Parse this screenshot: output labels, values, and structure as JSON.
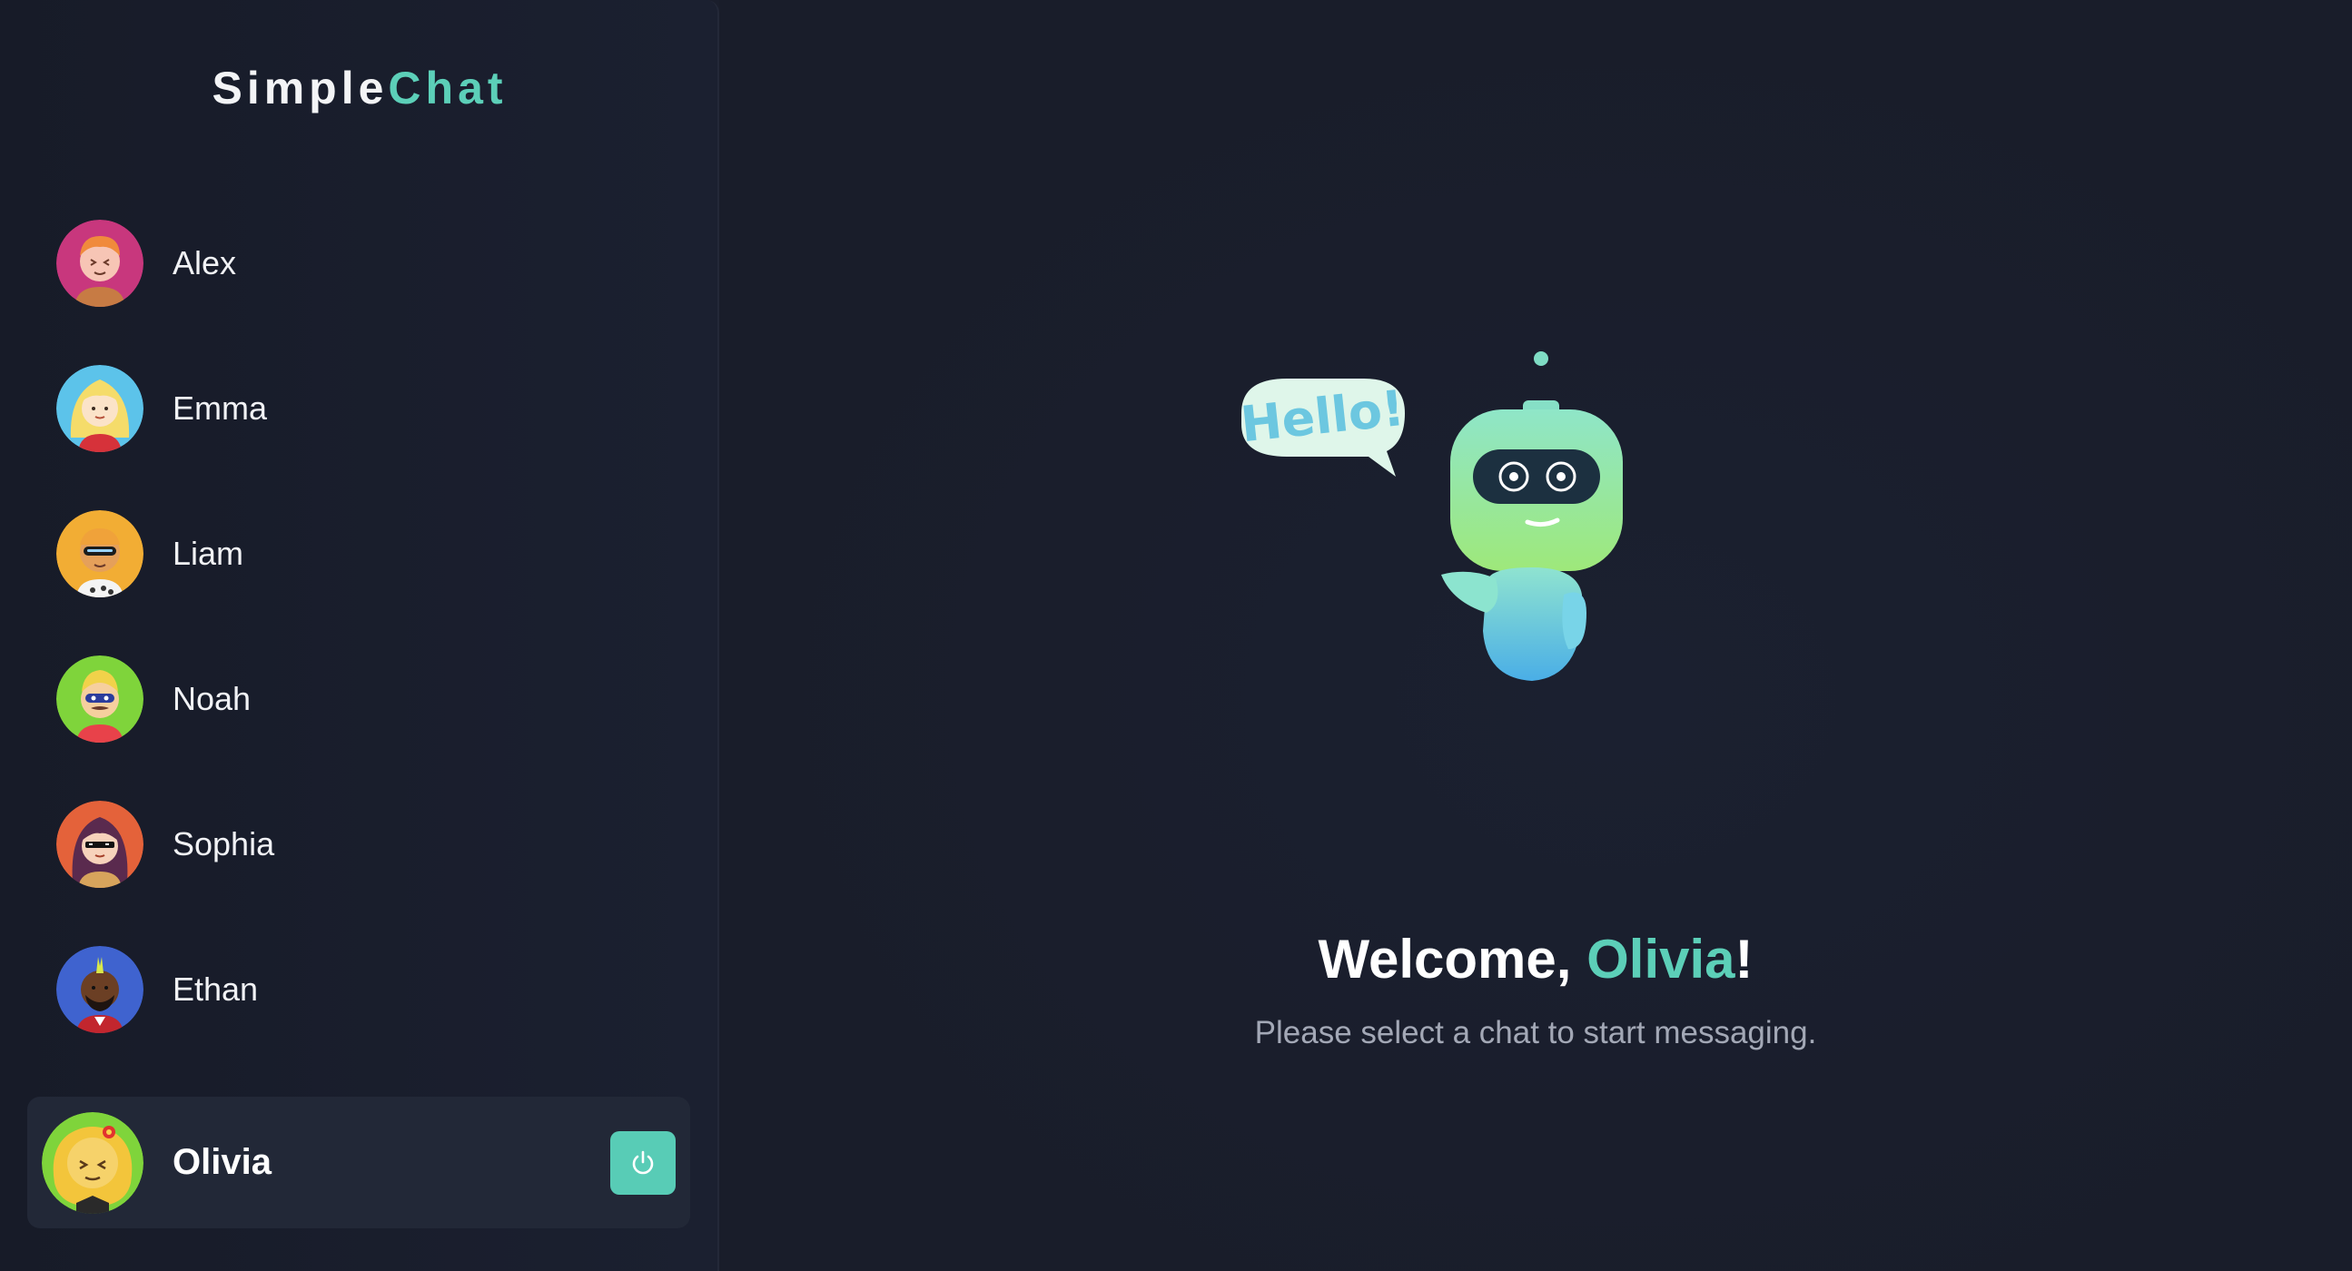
{
  "brand": {
    "part1": "Simple",
    "part2": "Chat"
  },
  "contacts": [
    {
      "name": "Alex"
    },
    {
      "name": "Emma"
    },
    {
      "name": "Liam"
    },
    {
      "name": "Noah"
    },
    {
      "name": "Sophia"
    },
    {
      "name": "Ethan"
    }
  ],
  "current_user": {
    "name": "Olivia",
    "logout_icon": "power-icon"
  },
  "main": {
    "illustration_bubble": "Hello!",
    "welcome_prefix": "Welcome, ",
    "welcome_name": "Olivia",
    "welcome_suffix": "!",
    "subtitle": "Please select a chat to start messaging."
  },
  "colors": {
    "accent": "#5ccfb8",
    "background": "#1a1e2c",
    "sidebar": "#171b28",
    "user_card": "#222837"
  }
}
